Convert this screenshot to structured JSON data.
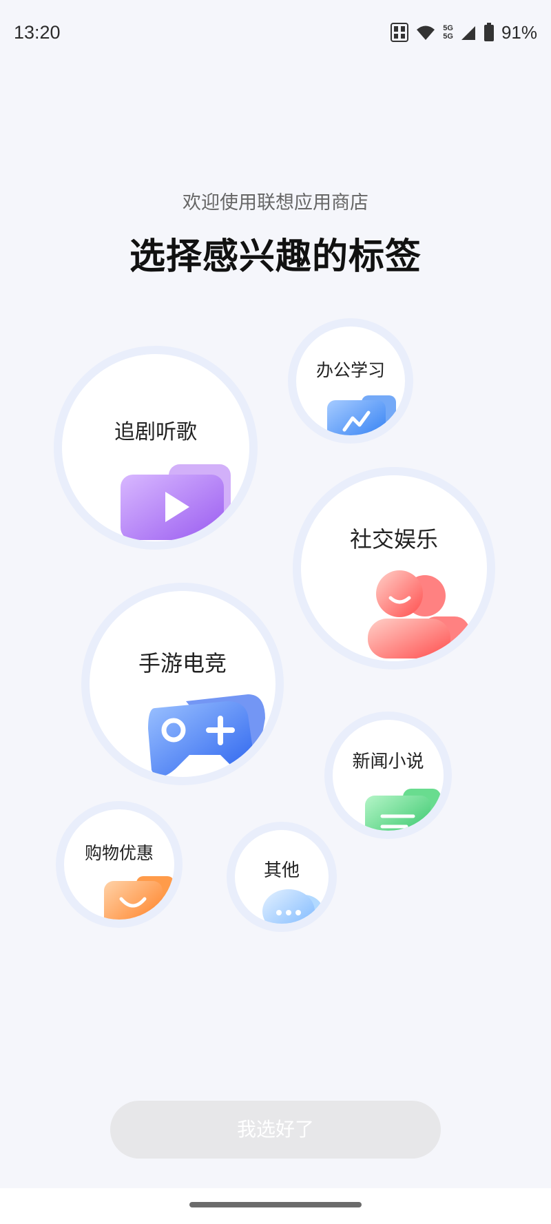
{
  "status_bar": {
    "time": "13:20",
    "network_top": "5G",
    "network_bottom": "5G",
    "battery": "91%",
    "icons": [
      "hd-icon",
      "wifi-icon",
      "signal-icon",
      "battery-icon"
    ]
  },
  "header": {
    "subtitle": "欢迎使用联想应用商店",
    "title": "选择感兴趣的标签"
  },
  "tags": [
    {
      "label": "追剧听歌",
      "icon": "play-icon",
      "color": "#a66cf0"
    },
    {
      "label": "办公学习",
      "icon": "chart-icon",
      "color": "#3f8cf5"
    },
    {
      "label": "社交娱乐",
      "icon": "people-icon",
      "color": "#ff5a5a"
    },
    {
      "label": "手游电竞",
      "icon": "gamepad-icon",
      "color": "#3a6ff2"
    },
    {
      "label": "新闻小说",
      "icon": "document-icon",
      "color": "#3ccf6a"
    },
    {
      "label": "购物优惠",
      "icon": "shopping-bag-icon",
      "color": "#ff8a2a"
    },
    {
      "label": "其他",
      "icon": "chat-icon",
      "color": "#7ab8ff"
    }
  ],
  "footer": {
    "confirm_label": "我选好了"
  }
}
